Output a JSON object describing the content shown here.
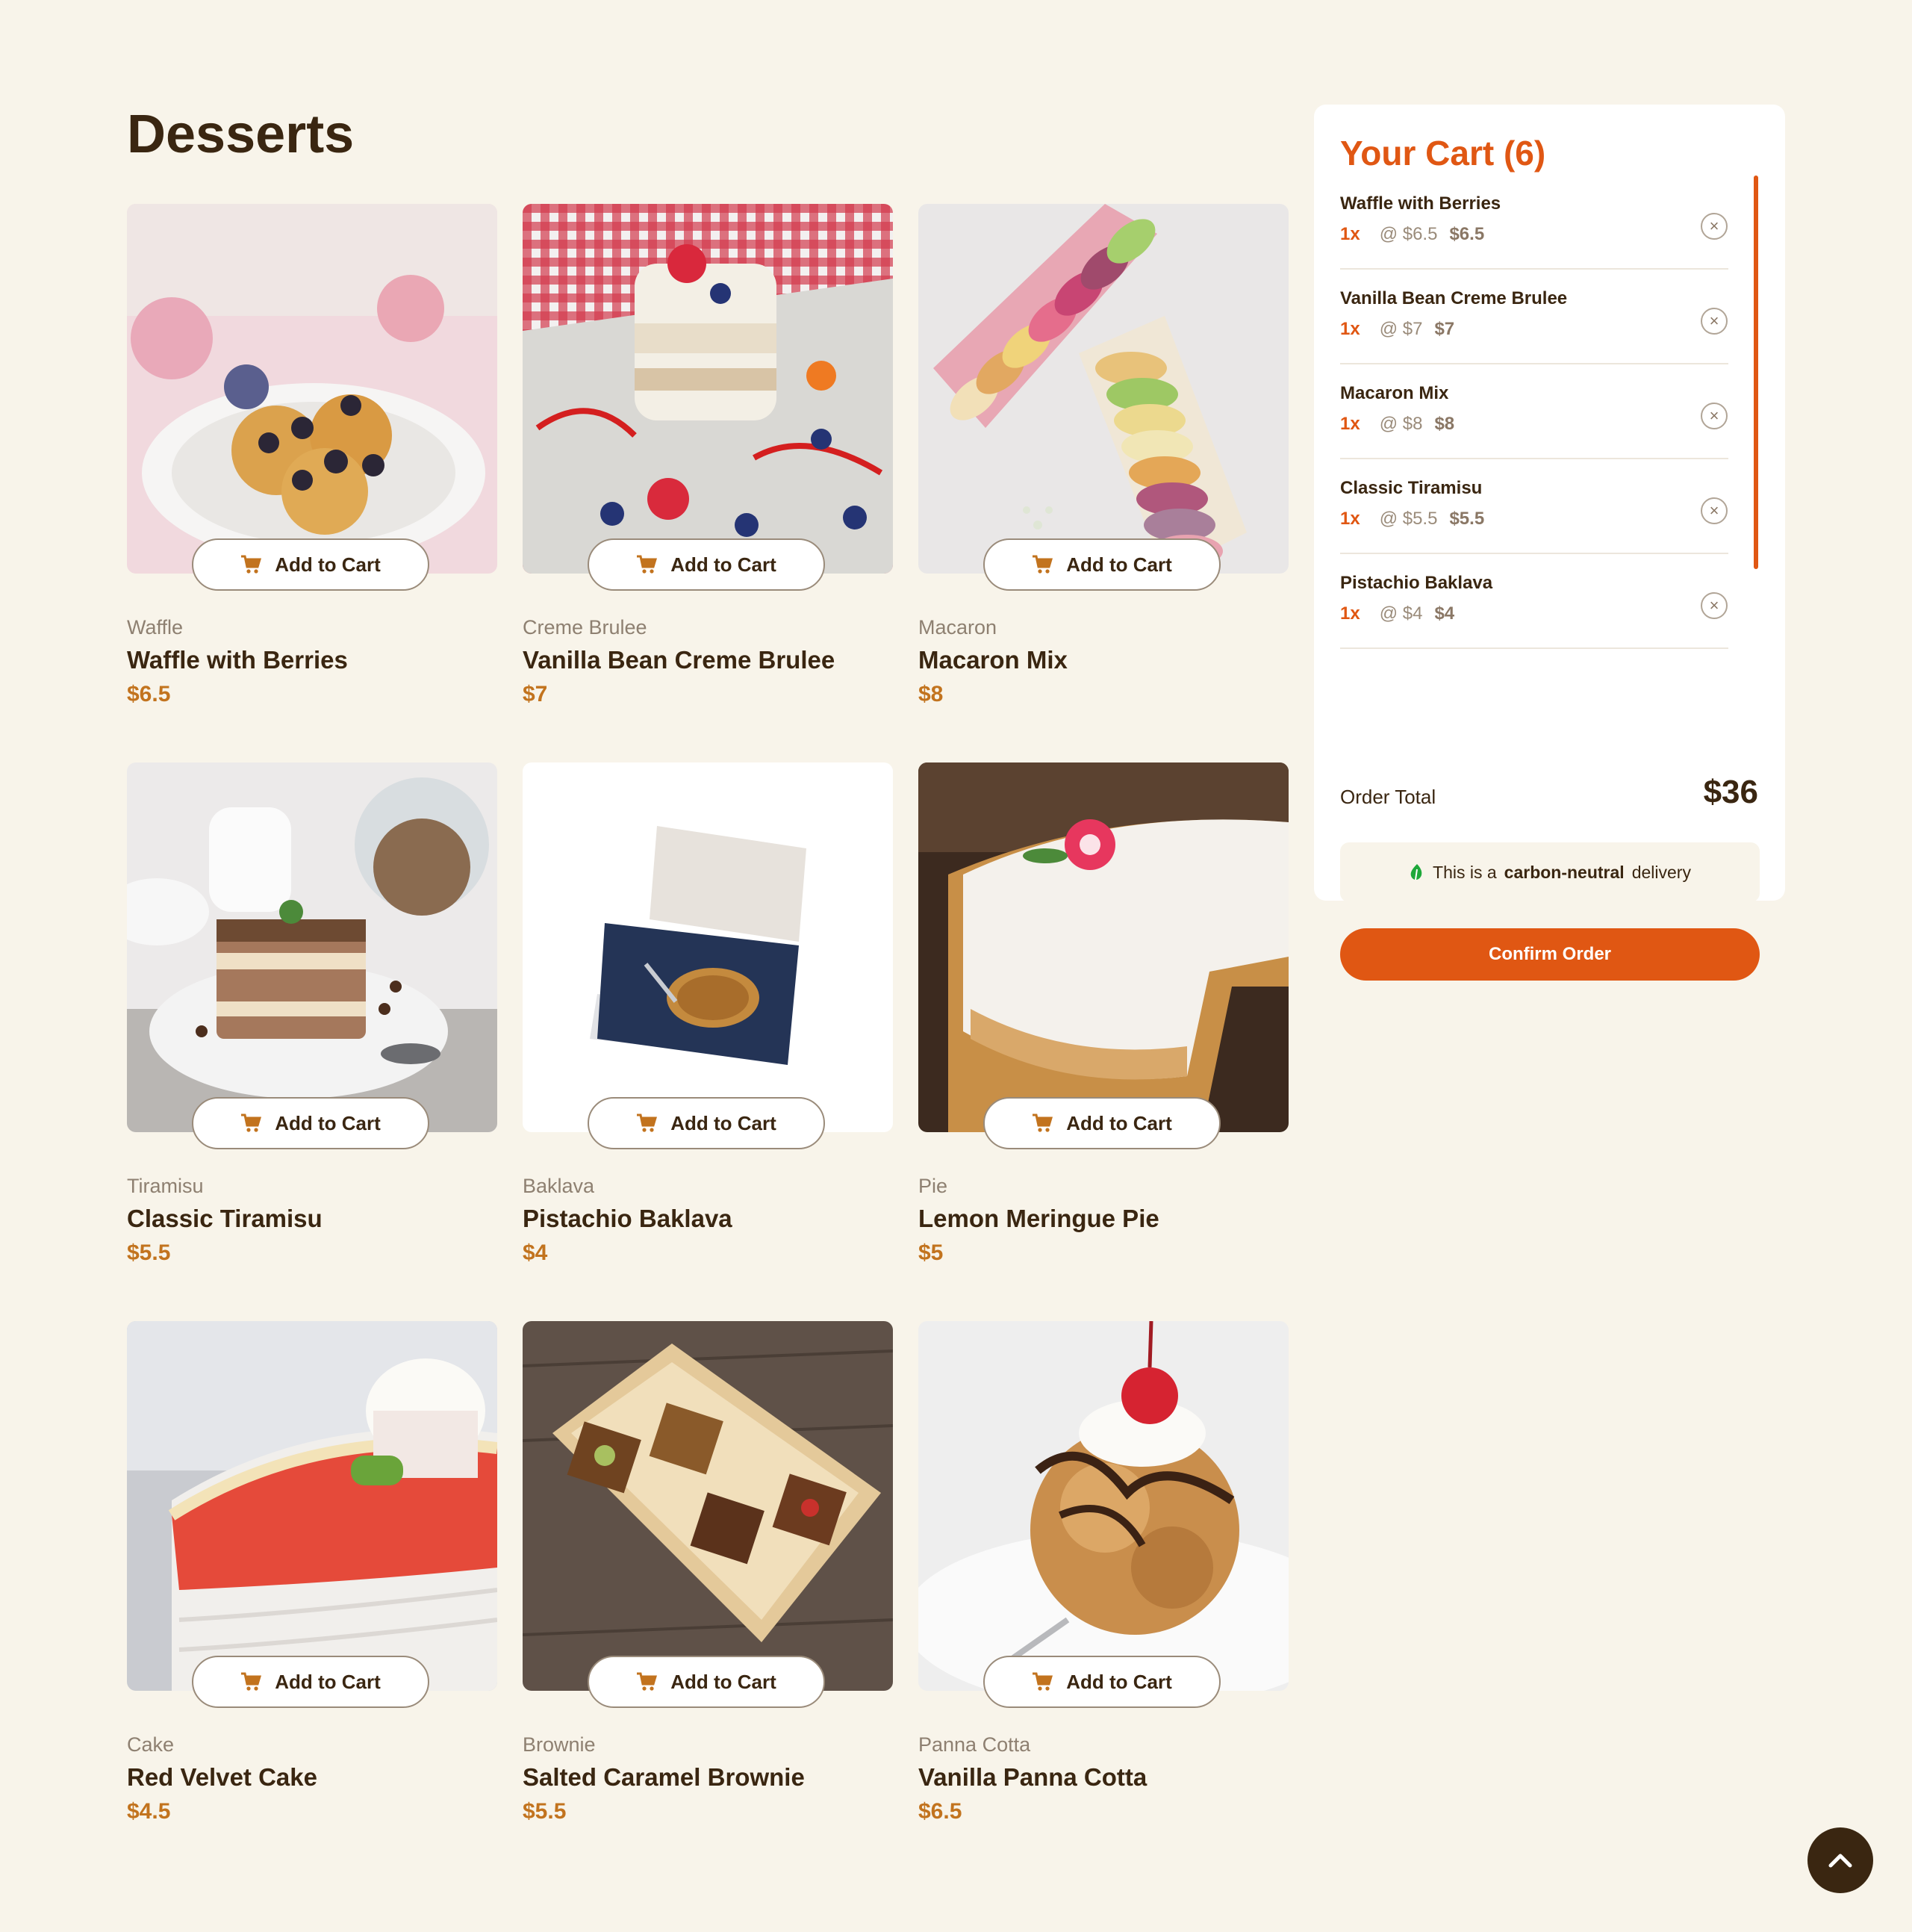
{
  "page": {
    "title": "Desserts"
  },
  "products": [
    {
      "category": "Waffle",
      "name": "Waffle with Berries",
      "price": "$6.5",
      "add_label": "Add to Cart"
    },
    {
      "category": "Creme Brulee",
      "name": "Vanilla Bean Creme Brulee",
      "price": "$7",
      "add_label": "Add to Cart"
    },
    {
      "category": "Macaron",
      "name": "Macaron Mix",
      "price": "$8",
      "add_label": "Add to Cart"
    },
    {
      "category": "Tiramisu",
      "name": "Classic Tiramisu",
      "price": "$5.5",
      "add_label": "Add to Cart"
    },
    {
      "category": "Baklava",
      "name": "Pistachio Baklava",
      "price": "$4",
      "add_label": "Add to Cart"
    },
    {
      "category": "Pie",
      "name": "Lemon Meringue Pie",
      "price": "$5",
      "add_label": "Add to Cart"
    },
    {
      "category": "Cake",
      "name": "Red Velvet Cake",
      "price": "$4.5",
      "add_label": "Add to Cart"
    },
    {
      "category": "Brownie",
      "name": "Salted Caramel Brownie",
      "price": "$5.5",
      "add_label": "Add to Cart"
    },
    {
      "category": "Panna Cotta",
      "name": "Vanilla Panna Cotta",
      "price": "$6.5",
      "add_label": "Add to Cart"
    }
  ],
  "cart": {
    "title": "Your Cart (6)",
    "items": [
      {
        "name": "Waffle with Berries",
        "qty": "1x",
        "unit": "@ $6.5",
        "subtotal": "$6.5"
      },
      {
        "name": "Vanilla Bean Creme Brulee",
        "qty": "1x",
        "unit": "@ $7",
        "subtotal": "$7"
      },
      {
        "name": "Macaron Mix",
        "qty": "1x",
        "unit": "@ $8",
        "subtotal": "$8"
      },
      {
        "name": "Classic Tiramisu",
        "qty": "1x",
        "unit": "@ $5.5",
        "subtotal": "$5.5"
      },
      {
        "name": "Pistachio Baklava",
        "qty": "1x",
        "unit": "@ $4",
        "subtotal": "$4"
      }
    ],
    "order_total_label": "Order Total",
    "order_total": "$36",
    "carbon_prefix": "This is a",
    "carbon_bold": "carbon-neutral",
    "carbon_suffix": "delivery",
    "confirm_label": "Confirm Order"
  },
  "colors": {
    "accent": "#e05713",
    "price": "#c2731e",
    "text": "#3a2611",
    "background": "#f8f4ea",
    "eco_green": "#1ea83a"
  },
  "icons": {
    "add_button": "cart-icon",
    "remove": "close-circle-icon",
    "carbon": "leaf-icon",
    "back_to_top": "chevron-up-icon"
  }
}
